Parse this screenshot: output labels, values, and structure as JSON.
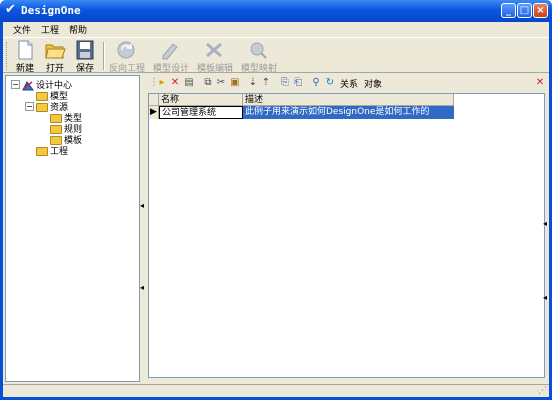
{
  "window": {
    "title": "DesignOne"
  },
  "menu": [
    "文件",
    "工程",
    "帮助"
  ],
  "toolbar": {
    "new": "新建",
    "open": "打开",
    "save": "保存",
    "reverse": "反向工程",
    "model_design": "模型设计",
    "model_edit": "模板编辑",
    "model_map": "模型映射"
  },
  "tree": {
    "root": "设计中心",
    "model": "模型",
    "resources": "资源",
    "type": "类型",
    "rule": "规则",
    "template": "模板",
    "project": "工程"
  },
  "right_toolbar": {
    "relation": "关系",
    "object": "对象"
  },
  "grid": {
    "headers": [
      "名称",
      "描述"
    ],
    "rows": [
      {
        "name": "公司管理系统",
        "desc": "此例子用来演示如何DesignOne是如何工作的"
      }
    ]
  }
}
